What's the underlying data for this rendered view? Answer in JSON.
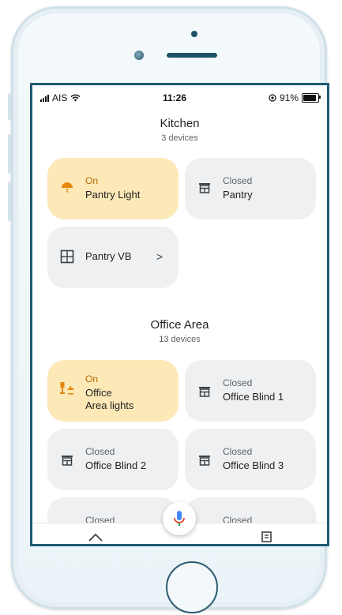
{
  "status_bar": {
    "carrier": "AIS",
    "time": "11:26",
    "battery": "91%"
  },
  "sections": [
    {
      "title": "Kitchen",
      "subtitle": "3 devices",
      "devices": [
        {
          "state": "On",
          "name": "Pantry Light",
          "icon": "pendant-light-icon",
          "active": true
        },
        {
          "state": "Closed",
          "name": "Pantry",
          "icon": "blind-icon",
          "active": false
        },
        {
          "state": "",
          "name": "Pantry VB",
          "icon": "window-grid-icon",
          "active": false,
          "chevron": ">"
        }
      ]
    },
    {
      "title": "Office Area",
      "subtitle": "13 devices",
      "devices": [
        {
          "state": "On",
          "name_line1": "Office",
          "name_line2": "Area lights",
          "icon": "desk-lamp-icon",
          "active": true
        },
        {
          "state": "Closed",
          "name": "Office Blind 1",
          "icon": "blind-icon",
          "active": false
        },
        {
          "state": "Closed",
          "name": "Office Blind 2",
          "icon": "blind-icon",
          "active": false
        },
        {
          "state": "Closed",
          "name": "Office Blind 3",
          "icon": "blind-icon",
          "active": false
        },
        {
          "state": "Closed",
          "icon": "blind-icon",
          "active": false
        },
        {
          "state": "Closed",
          "icon": "blind-icon",
          "active": false
        }
      ]
    }
  ],
  "colors": {
    "tile_on": "#fde9b8",
    "tile_off": "#eef0f2",
    "accent_on": "#b36a00",
    "frame": "#1f5a73"
  }
}
